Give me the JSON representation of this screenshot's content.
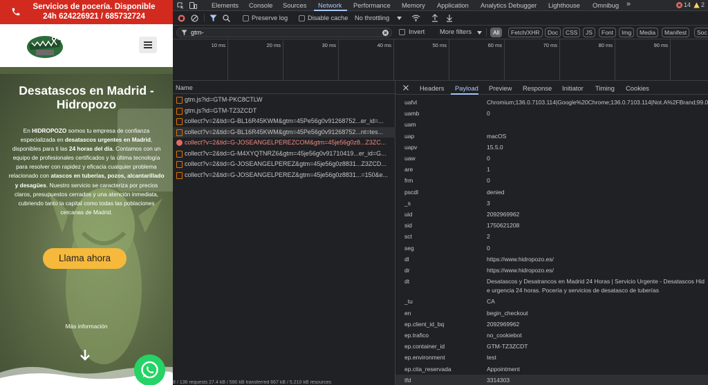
{
  "website": {
    "topbar_text": "Servicios de pocería. Disponible 24h 624226921 / 685732724",
    "hero_title": "Desatascos en Madrid - Hidropozo",
    "hero_body": [
      {
        "t": "En ",
        "b": false
      },
      {
        "t": "HIDROPOZO",
        "b": true
      },
      {
        "t": " somos tu empresa de confianza especializada en ",
        "b": false
      },
      {
        "t": "desatascos urgentes en Madrid",
        "b": true
      },
      {
        "t": ", disponibles para ti las ",
        "b": false
      },
      {
        "t": "24 horas del día",
        "b": true
      },
      {
        "t": ". Contamos con un equipo de profesionales certificados y la última tecnología para resolver con rapidez y eficacia cualquier problema relacionado con ",
        "b": false
      },
      {
        "t": "atascos en tuberías, pozos, alcantarillado y desagües",
        "b": true
      },
      {
        "t": ". Nuestro servicio se caracteriza por precios claros, presupuestos cerrados y una atención inmediata, cubriendo tanto la capital como todas las poblaciones cercanas de Madrid.",
        "b": false
      }
    ],
    "cta_label": "Llama ahora",
    "more_info": "Más información",
    "colors": {
      "topbar": "#d32a1f",
      "cta": "#f6b93b",
      "whatsapp": "#25d366"
    }
  },
  "devtools": {
    "tabs": [
      "Elements",
      "Console",
      "Sources",
      "Network",
      "Performance",
      "Memory",
      "Application",
      "Analytics Debugger",
      "Lighthouse",
      "Omnibug"
    ],
    "active_tab": "Network",
    "more_tabs": "»",
    "errors_count": "14",
    "warnings_count": "2",
    "toolbar": {
      "preserve_log": "Preserve log",
      "disable_cache": "Disable cache",
      "throttling": "No throttling"
    },
    "filter": {
      "value": "gtm-",
      "invert": "Invert",
      "more_filters": "More filters",
      "chips": [
        "All",
        "Fetch/XHR",
        "Doc",
        "CSS",
        "JS",
        "Font",
        "Img",
        "Media",
        "Manifest",
        "Soc"
      ],
      "active_chip": "All"
    },
    "timeline_ticks": [
      "10 ms",
      "20 ms",
      "30 ms",
      "40 ms",
      "50 ms",
      "60 ms",
      "70 ms",
      "80 ms",
      "90 ms"
    ],
    "list_header": "Name",
    "requests": [
      {
        "name": "gtm.js?id=GTM-PKC8CTLW",
        "error": false,
        "selected": false
      },
      {
        "name": "gtm.js?id=GTM-TZ3ZCDT",
        "error": false,
        "selected": false
      },
      {
        "name": "collect?v=2&tid=G-BL16R45KWM&gtm=45Pe56g0v91268752...er_id=...",
        "error": false,
        "selected": false
      },
      {
        "name": "collect?v=2&tid=G-BL16R45KWM&gtm=45Pe56g0v91268752...nt=tes...",
        "error": false,
        "selected": true
      },
      {
        "name": "collect?v=2&tid=G-JOSEANGELPEREZCOM&gtm=45je56g0z8...Z3ZC...",
        "error": true,
        "selected": false
      },
      {
        "name": "collect?v=2&tid=G-M4XYQTNRZ6&gtm=45je56g0v91710419...er_id=G...",
        "error": false,
        "selected": false
      },
      {
        "name": "collect?v=2&tid=G-JOSEANGELPEREZ&gtm=45je56g0z8831...Z3ZCD...",
        "error": false,
        "selected": false
      },
      {
        "name": "collect?v=2&tid=G-JOSEANGELPEREZ&gtm=45je56g0z8831...=150&e...",
        "error": false,
        "selected": false
      }
    ],
    "status_bar": "8 / 136 requests   27.4 kB / 590 kB transferred   667 kB / 5.210 kB resources",
    "detail_tabs": [
      "Headers",
      "Payload",
      "Preview",
      "Response",
      "Initiator",
      "Timing",
      "Cookies"
    ],
    "active_detail_tab": "Payload",
    "payload": [
      {
        "k": "uafvl",
        "v": "Chromium;136.0.7103.114|Google%20Chrome;136.0.7103.114|Not.A%2FBrand;99.0"
      },
      {
        "k": "uamb",
        "v": "0"
      },
      {
        "k": "uam",
        "v": ""
      },
      {
        "k": "uap",
        "v": "macOS"
      },
      {
        "k": "uapv",
        "v": "15.5.0"
      },
      {
        "k": "uaw",
        "v": "0"
      },
      {
        "k": "are",
        "v": "1"
      },
      {
        "k": "frm",
        "v": "0"
      },
      {
        "k": "pscdl",
        "v": "denied"
      },
      {
        "k": "_s",
        "v": "3"
      },
      {
        "k": "uid",
        "v": "2092969962"
      },
      {
        "k": "sid",
        "v": "1750621208"
      },
      {
        "k": "sct",
        "v": "2"
      },
      {
        "k": "seg",
        "v": "0"
      },
      {
        "k": "dl",
        "v": "https://www.hidropozo.es/"
      },
      {
        "k": "dr",
        "v": "https://www.hidropozo.es/"
      },
      {
        "k": "dt",
        "v": "Desatascos y Desatrancos en Madrid 24 Horas | Servicio Urgente - Desatascos Hid",
        "v2": "e urgencia 24 horas. Pocería y servicios de desatasco de tuberías"
      },
      {
        "k": "_tu",
        "v": "CA"
      },
      {
        "k": "en",
        "v": "begin_checkout"
      },
      {
        "k": "ep.client_id_bq",
        "v": "2092969962"
      },
      {
        "k": "ep.trafico",
        "v": "no_cookiebot"
      },
      {
        "k": "ep.container_id",
        "v": "GTM-TZ3ZCDT"
      },
      {
        "k": "ep.environment",
        "v": "test"
      },
      {
        "k": "ep.cita_reservada",
        "v": "Appointment"
      },
      {
        "k": "tfd",
        "v": "3314303"
      }
    ],
    "colors": {
      "accent": "#a8c7fa",
      "error": "#f28b82",
      "bg": "#202124"
    }
  }
}
